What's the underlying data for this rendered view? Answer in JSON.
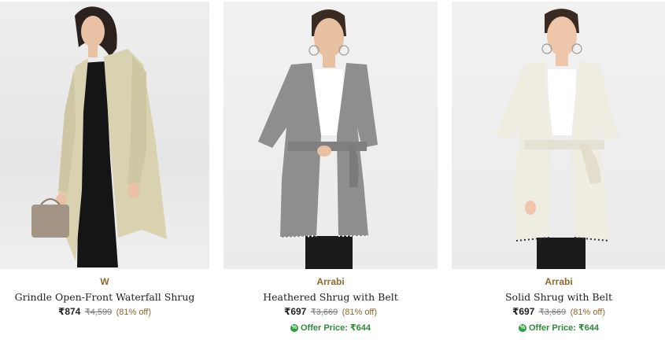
{
  "products": [
    {
      "brand": "W",
      "name": "Grindle Open-Front Waterfall Shrug",
      "price": "₹874",
      "mrp": "₹4,599",
      "discount": "(81% off)",
      "offer": "",
      "colors": {
        "garment": "#d9d2b0",
        "inner": "#151515",
        "pants": "#1a1a1a",
        "skin": "#e9c2a6",
        "hair": "#2b2220",
        "bag": "#a39586"
      }
    },
    {
      "brand": "Arrabi",
      "name": "Heathered Shrug with Belt",
      "price": "₹697",
      "mrp": "₹3,669",
      "discount": "(81% off)",
      "offer": "Offer Price: ₹644",
      "colors": {
        "garment": "#8e8e8e",
        "inner": "#ffffff",
        "pants": "#1b1b1b",
        "skin": "#e8c0a2",
        "hair": "#3a2b22"
      }
    },
    {
      "brand": "Arrabi",
      "name": "Solid Shrug with Belt",
      "price": "₹697",
      "mrp": "₹3,669",
      "discount": "(81% off)",
      "offer": "Offer Price: ₹644",
      "colors": {
        "garment": "#efece1",
        "inner": "#ffffff",
        "pants": "#1b1b1b",
        "skin": "#eec6aa",
        "hair": "#3a2b22"
      }
    }
  ]
}
